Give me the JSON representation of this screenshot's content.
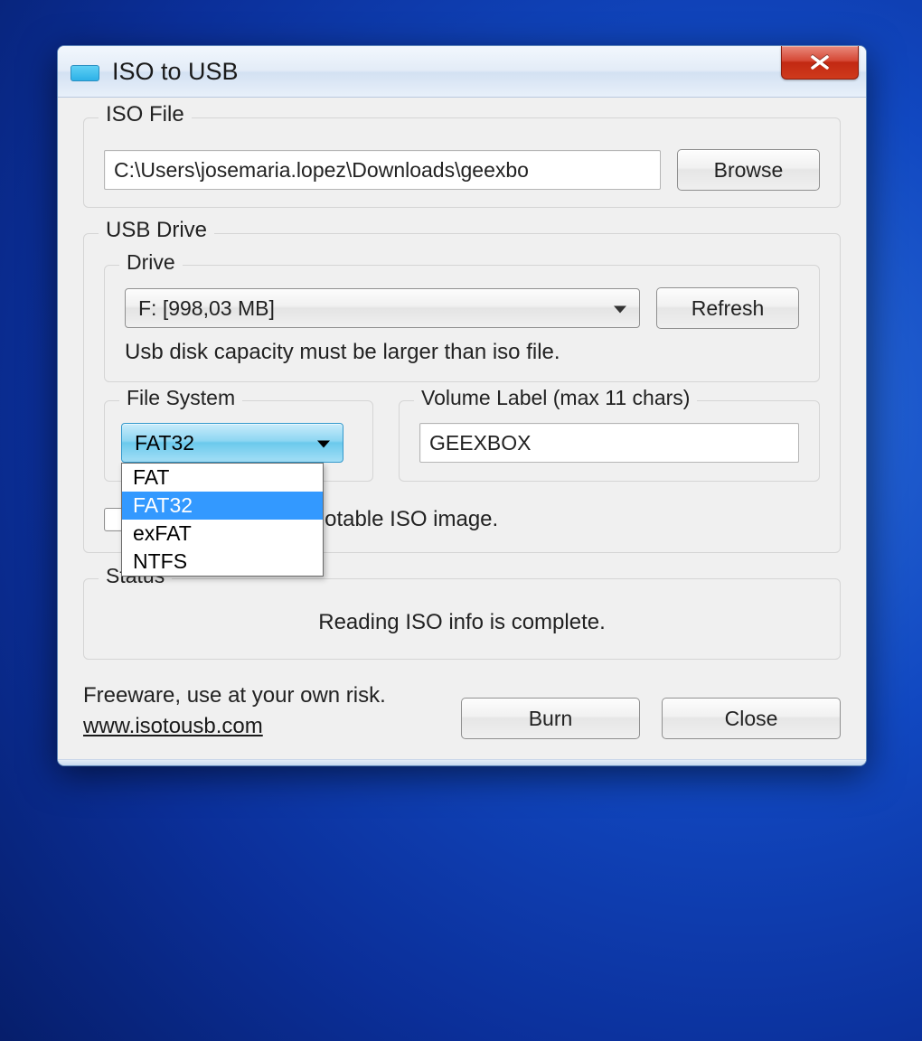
{
  "window": {
    "title": "ISO to USB"
  },
  "iso": {
    "legend": "ISO File",
    "path": "C:\\Users\\josemaria.lopez\\Downloads\\geexbo",
    "browse": "Browse"
  },
  "usb": {
    "legend": "USB Drive",
    "drive_legend": "Drive",
    "drive_value": "F: [998,03 MB]",
    "refresh": "Refresh",
    "hint": "Usb disk capacity must be larger than iso file."
  },
  "fs": {
    "legend": "File System",
    "value": "FAT32",
    "options": [
      "FAT",
      "FAT32",
      "exFAT",
      "NTFS"
    ],
    "selected_index": 1
  },
  "volume": {
    "legend": "Volume Label (max 11 chars)",
    "value": "GEEXBOX"
  },
  "bootable": {
    "label_partial": "pports Windows bootable ISO image."
  },
  "status": {
    "legend": "Status",
    "text": "Reading ISO info is complete."
  },
  "footer": {
    "note": "Freeware, use at your own risk.",
    "link": "www.isotousb.com",
    "burn": "Burn",
    "close": "Close"
  }
}
